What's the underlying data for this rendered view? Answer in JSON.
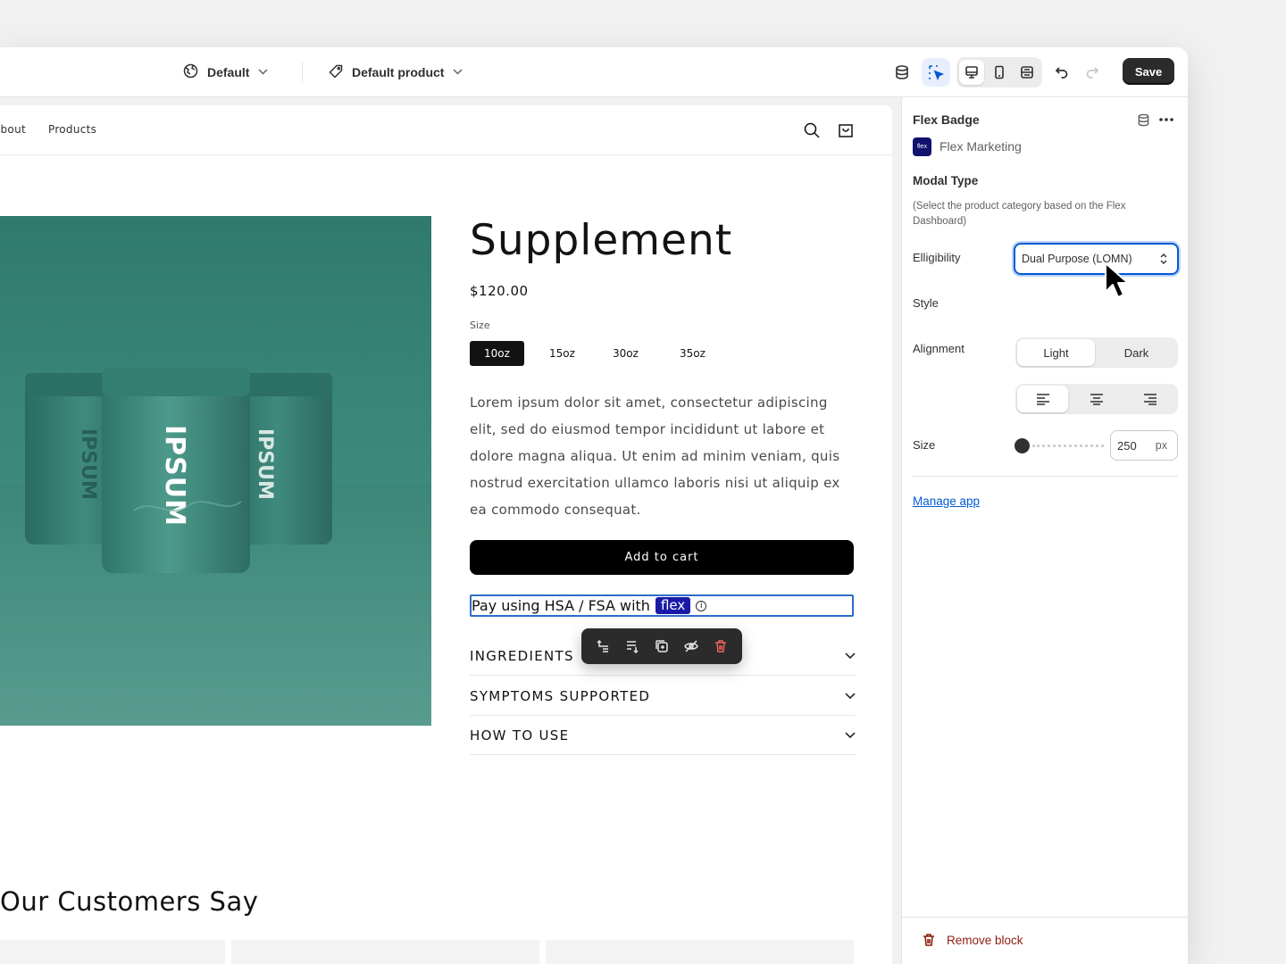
{
  "topbar": {
    "locale_label": "Default",
    "template_label": "Default product",
    "save_label": "Save"
  },
  "store": {
    "nav_links": [
      "About",
      "Products"
    ],
    "product_title": "Supplement",
    "price": "$120.00",
    "size_label": "Size",
    "sizes": [
      "10oz",
      "15oz",
      "30oz",
      "35oz"
    ],
    "selected_size": "10oz",
    "description": "Lorem ipsum dolor sit amet, consectetur adipiscing elit, sed do eiusmod tempor incididunt ut labore et dolore magna aliqua. Ut enim ad minim veniam, quis nostrud exercitation ullamco laboris nisi ut aliquip ex ea commodo consequat.",
    "add_to_cart": "Add to cart",
    "flex_badge_text": "Pay using HSA / FSA with",
    "flex_pill": "flex",
    "accordions": [
      "INGREDIENTS",
      "SYMPTOMS SUPPORTED",
      "HOW TO USE"
    ],
    "section_title": "Our Customers Say",
    "jar_brand": "IPSUM"
  },
  "panel": {
    "title": "Flex Badge",
    "app_logo_text": "flex",
    "app_name": "Flex Marketing",
    "section_heading": "Modal Type",
    "hint": "(Select the product category based on the Flex Dashboard)",
    "eligibility_label": "Elligibility",
    "eligibility_value": "Dual Purpose (LOMN)",
    "style_label": "Style",
    "style_options": [
      "Light",
      "Dark"
    ],
    "style_selected": "Light",
    "alignment_label": "Alignment",
    "alignment_selected": "left",
    "size_label": "Size",
    "size_value": "250",
    "size_unit": "px",
    "manage_link": "Manage app",
    "remove_label": "Remove block"
  },
  "colors": {
    "accent": "#005bd3",
    "product_bg": "#3e8b7c",
    "flex_pill": "#1a1aa6",
    "danger": "#8e1f0b"
  }
}
